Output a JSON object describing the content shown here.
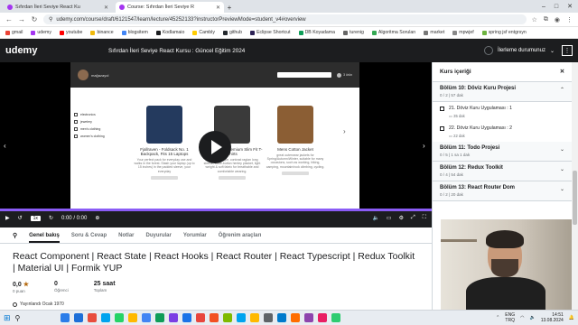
{
  "browser": {
    "tabs": [
      {
        "title": "Sıfırdan İleri Seviye React Ku",
        "active": false
      },
      {
        "title": "Course: Sıfırdan İleri Seviye R",
        "active": true
      }
    ],
    "new_tab": "+",
    "window_controls": [
      "–",
      "□",
      "✕"
    ],
    "url": "udemy.com/course/draft/6121547/learn/lecture/45252133?instructorPreviewMode=student_v4#overview",
    "bookmarks": [
      {
        "label": "gmail",
        "color": "#ea4335"
      },
      {
        "label": "udemy",
        "color": "#a435f0"
      },
      {
        "label": "youtube",
        "color": "#ff0000"
      },
      {
        "label": "binance",
        "color": "#f0b90b"
      },
      {
        "label": "blogsitem",
        "color": "#4285f4"
      },
      {
        "label": "Kodlamaio",
        "color": "#1c1d1f"
      },
      {
        "label": "Cambly",
        "color": "#ffcc00"
      },
      {
        "label": "github",
        "color": "#24292e"
      },
      {
        "label": "Eclipse Shortcut",
        "color": "#2c2255"
      },
      {
        "label": "DB Koyadama",
        "color": "#0f9d58"
      },
      {
        "label": "turenig",
        "color": "#666666"
      },
      {
        "label": "Algoritma Soruları",
        "color": "#34a853"
      },
      {
        "label": "market",
        "color": "#777777"
      },
      {
        "label": "mpwjef",
        "color": "#888888"
      },
      {
        "label": "spring jsf entgrsyn",
        "color": "#6db33f"
      }
    ]
  },
  "header": {
    "logo": "udemy",
    "course_title": "Sıfırdan İleri Seviye React Kursu : Güncel Eğitim 2024",
    "progress_label": "İlerleme durumunuz",
    "progress_value": 0,
    "more": "⋮"
  },
  "video": {
    "store_header": {
      "store": "mağazayol",
      "cart_count": "3 ürün"
    },
    "filters": [
      "electronics",
      "jewelery",
      "men's clothing",
      "women's clothing"
    ],
    "products": [
      {
        "name": "Fjallraven - Foldsack No. 1 Backpack, Fits 15 Laptops",
        "color": "#243a5e",
        "desc": "Your perfect pack for everyday use and walks in the forest. Stash your laptop (up to 15 inches) in the padded sleeve, your everyday",
        "price": "109.95$"
      },
      {
        "name": "Mens Casual Premium Slim Fit T-Shirts",
        "color": "#3a3a3a",
        "desc": "Slim-fitting style, contrast raglan long sleeve, three-button henley placket, light weight & soft fabric for breathable and comfortable wearing.",
        "price": "22.3$"
      },
      {
        "name": "Mens Cotton Jacket",
        "color": "#8b5e34",
        "desc": "great outerwear jackets for Spring/Autumn/Winter, suitable for many occasions, such as working, hiking, camping, mountain/rock climbing, cycling.",
        "price": "55.99$"
      }
    ],
    "controls": {
      "speed": "1x",
      "time": "0:00 / 0:00",
      "progress": 0
    }
  },
  "tabs": [
    "Genel bakış",
    "Soru & Cevap",
    "Notlar",
    "Duyurular",
    "Yorumlar",
    "Öğrenim araçları"
  ],
  "course_headline": "React Component | React State | React Hooks | React Router | React Typescript | Redux Toolkit | Material UI | Formik YUP",
  "stats": [
    {
      "value": "0,0",
      "label": "0 puan",
      "star": true
    },
    {
      "value": "0",
      "label": "Öğrenci",
      "star": false
    },
    {
      "value": "25 saat",
      "label": "Toplam",
      "star": false
    }
  ],
  "published": "Yayınlandı Ocak 1970",
  "sidebar": {
    "title": "Kurs içeriği",
    "close": "✕",
    "sections": [
      {
        "title": "Bölüm 10: Döviz Kuru Projesi",
        "sub": "0 / 2 | 57 dak",
        "expanded": true,
        "lessons": [
          {
            "title": "21. Döviz Kuru Uygulaması : 1",
            "dur": "35 dak"
          },
          {
            "title": "22. Döviz Kuru Uygulaması : 2",
            "dur": "22 dak"
          }
        ]
      },
      {
        "title": "Bölüm 11: Todo Projesi",
        "sub": "0 / 5 | 1 sa 1 dak",
        "expanded": false,
        "lessons": []
      },
      {
        "title": "Bölüm 12: Redux Toolkit",
        "sub": "0 / 4 | 54 dak",
        "expanded": false,
        "lessons": []
      },
      {
        "title": "Bölüm 13: React Router Dom",
        "sub": "0 / 2 | 20 dak",
        "expanded": false,
        "lessons": []
      }
    ]
  },
  "taskbar": {
    "apps": [
      "#2b7de9",
      "#1d6fd8",
      "#e84d3d",
      "#00a4ef",
      "#25d366",
      "#ffb900",
      "#4285f4",
      "#0f9d58",
      "#7b3fe4",
      "#1a73e8",
      "#e8453c",
      "#f25022",
      "#7fba00",
      "#00a4ef",
      "#ffb900",
      "#5f6368",
      "#007acc",
      "#ff6d00",
      "#8e44ad",
      "#e91e63",
      "#2ecc71"
    ],
    "lang": [
      "ENG",
      "TRQ"
    ],
    "time": "14:51",
    "date": "13.08.2024"
  }
}
